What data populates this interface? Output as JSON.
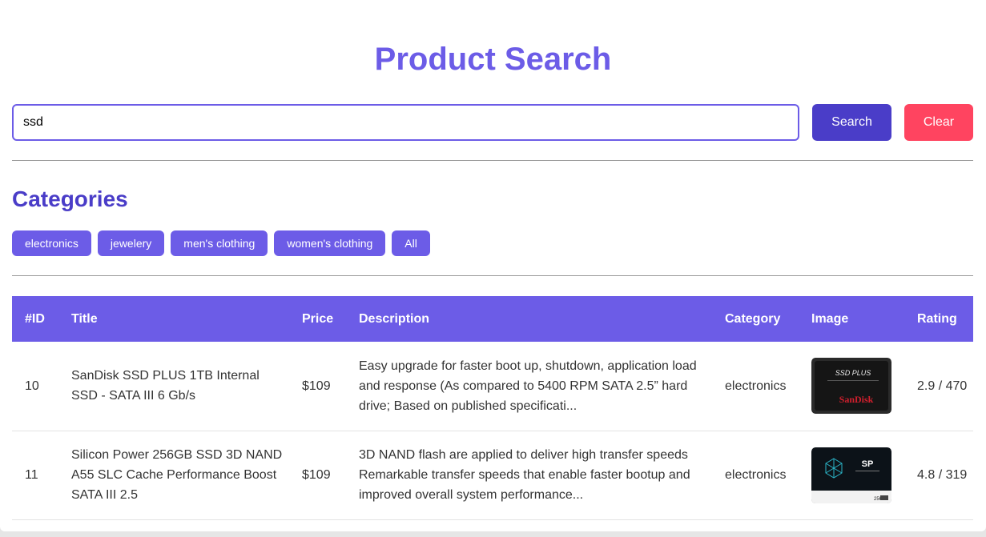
{
  "page": {
    "title": "Product Search"
  },
  "search": {
    "value": "ssd",
    "search_label": "Search",
    "clear_label": "Clear"
  },
  "categories": {
    "heading": "Categories",
    "items": [
      "electronics",
      "jewelery",
      "men's clothing",
      "women's clothing",
      "All"
    ]
  },
  "table": {
    "headers": [
      "#ID",
      "Title",
      "Price",
      "Description",
      "Category",
      "Image",
      "Rating"
    ],
    "rows": [
      {
        "id": "10",
        "title": "SanDisk SSD PLUS 1TB Internal SSD - SATA III 6 Gb/s",
        "price": "$109",
        "description": "Easy upgrade for faster boot up, shutdown, application load and response (As compared to 5400 RPM SATA 2.5” hard drive; Based on published specificati...",
        "category": "electronics",
        "image": {
          "line1": "SSD PLUS",
          "brand": "SanDisk"
        },
        "rating": "2.9 / 470"
      },
      {
        "id": "11",
        "title": "Silicon Power 256GB SSD 3D NAND A55 SLC Cache Performance Boost SATA III 2.5",
        "price": "$109",
        "description": "3D NAND flash are applied to deliver high transfer speeds Remarkable transfer speeds that enable faster bootup and improved overall system performance...",
        "category": "electronics",
        "image": {
          "brand": "SP",
          "capacity": "256"
        },
        "rating": "4.8 / 319"
      }
    ]
  }
}
